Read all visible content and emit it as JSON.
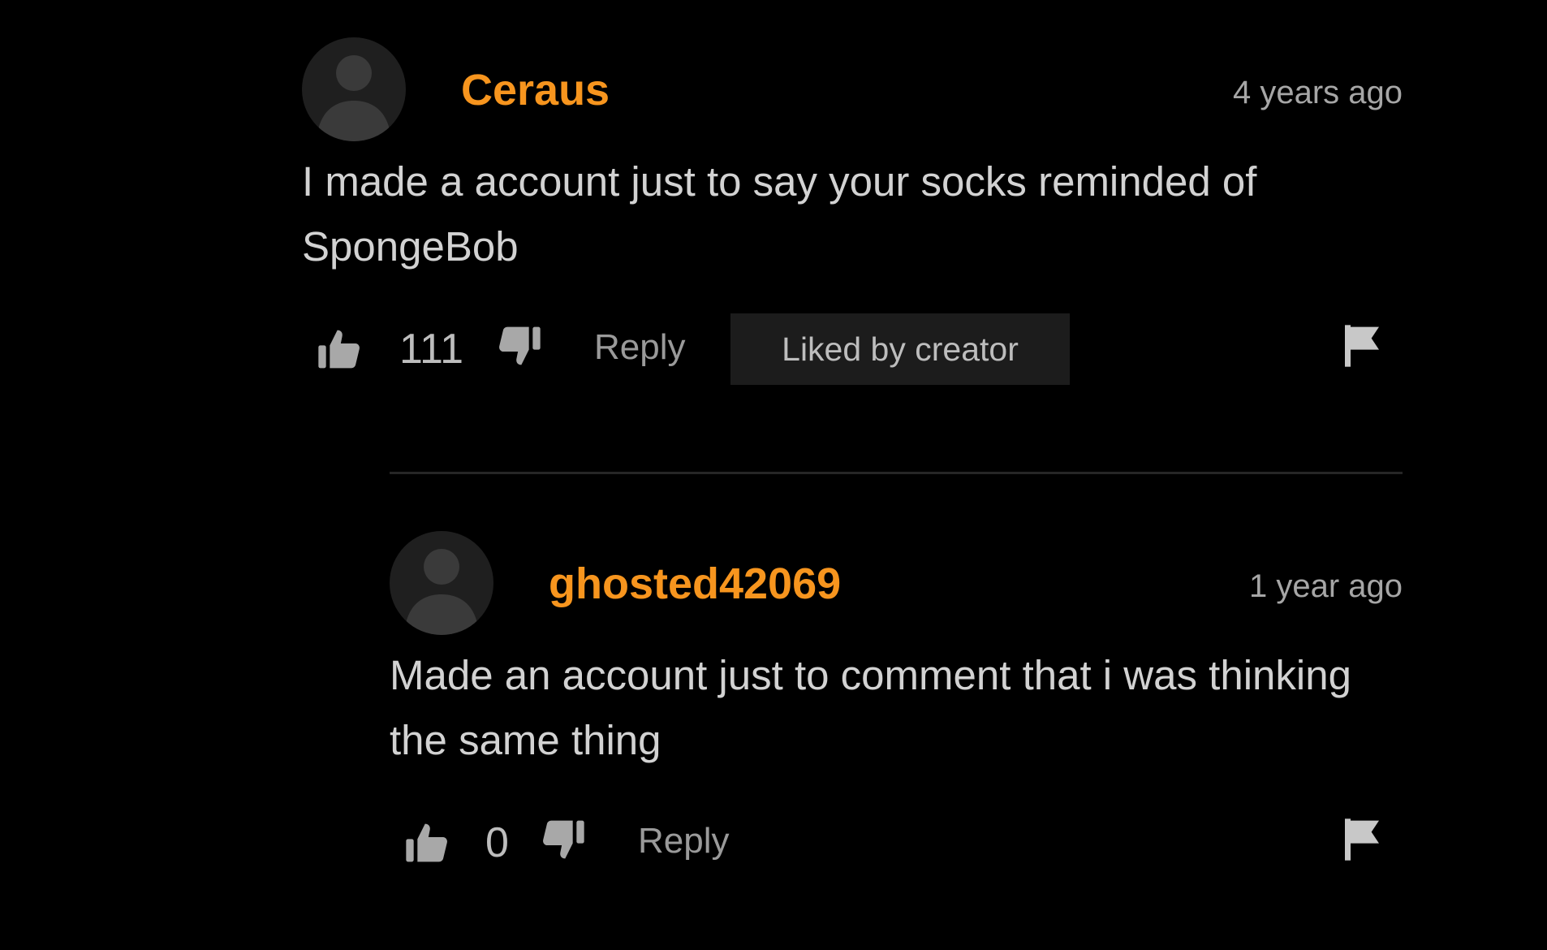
{
  "comments": [
    {
      "username": "Ceraus",
      "time": "4 years ago",
      "text": "I made a account just to say your socks reminded of SpongeBob",
      "likes": "111",
      "reply_label": "Reply",
      "badge": "Liked by creator"
    },
    {
      "username": "ghosted42069",
      "time": "1 year ago",
      "text": "Made an account just to comment that i was thinking the same thing",
      "likes": "0",
      "reply_label": "Reply"
    }
  ],
  "colors": {
    "background": "#000000",
    "username": "#f7951e",
    "body_text": "#d2d2d2",
    "meta_text": "#a6a6a6",
    "badge_bg": "#1c1c1c"
  },
  "icons": [
    "avatar-silhouette",
    "thumbs-up-icon",
    "thumbs-down-icon",
    "flag-icon"
  ]
}
